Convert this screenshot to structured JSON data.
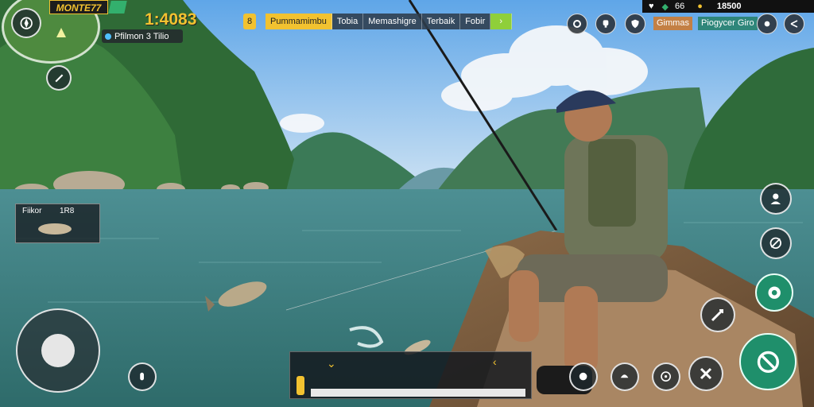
{
  "hud": {
    "player_name": "MONTE77",
    "score": "1:4083",
    "location_label": "Pfilmon 3 Tilio",
    "status_right": "18500",
    "status_mid": "66"
  },
  "tabs": {
    "left_badge": "8",
    "items": [
      {
        "label": "Pummamimbu",
        "active": true
      },
      {
        "label": "Tobia",
        "active": false
      },
      {
        "label": "Memashigre",
        "active": false
      },
      {
        "label": "Terbaik",
        "active": false
      },
      {
        "label": "Fobir",
        "active": false
      }
    ]
  },
  "right_top": {
    "tab1": "Gimmas",
    "tab2": "Piogycer Giro"
  },
  "catch_panel": {
    "label": "Fiikor",
    "value": "1R8"
  },
  "icons": {
    "map_marker": "map-pin-icon",
    "compass": "compass-icon",
    "settings": "settings-icon",
    "profile": "person-icon",
    "target": "target-icon",
    "reel": "reel-icon",
    "cast": "cast-icon",
    "action": "action-icon"
  },
  "colors": {
    "accent_yellow": "#f2c230",
    "accent_green": "#1f8f6b",
    "hud_dark": "#1e282d"
  }
}
